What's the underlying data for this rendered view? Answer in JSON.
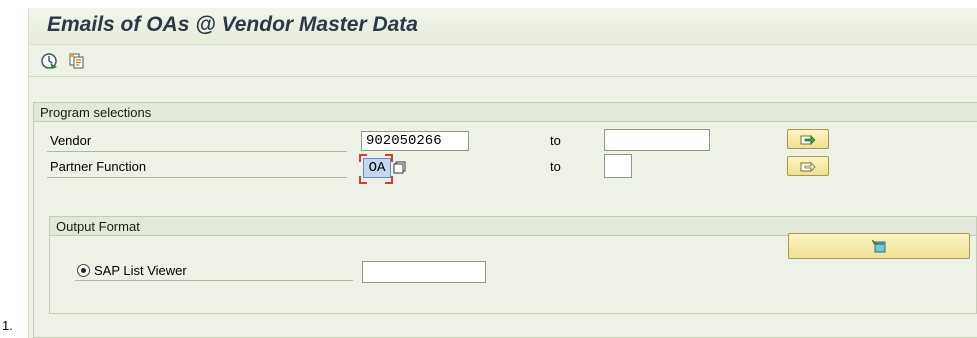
{
  "list_marker": "1.",
  "window": {
    "title": "Emails of OAs @ Vendor Master Data"
  },
  "toolbar": {
    "execute_icon": "execute-clock-icon",
    "variant_icon": "get-variant-icon"
  },
  "program_selections": {
    "header": "Program selections",
    "rows": [
      {
        "label": "Vendor",
        "low_value": "902050266",
        "to_label": "to",
        "high_value": "",
        "multiple_selection_icon": "multiple-selection-arrow-icon"
      },
      {
        "label": "Partner Function",
        "low_value": "OA",
        "to_label": "to",
        "high_value": "",
        "multiple_selection_icon": "multiple-selection-arrow-icon"
      }
    ]
  },
  "output_format": {
    "header": "Output Format",
    "layout_button_icon": "layout-selection-icon",
    "radio_label": "SAP List Viewer",
    "radio_selected": true,
    "layout_value": ""
  },
  "colors": {
    "background": "#eef2e6",
    "title_text": "#2b3a47",
    "button_yellow": "#f0e193",
    "selected_field": "#c4d6f0",
    "focus_corner": "#d83a3a"
  }
}
